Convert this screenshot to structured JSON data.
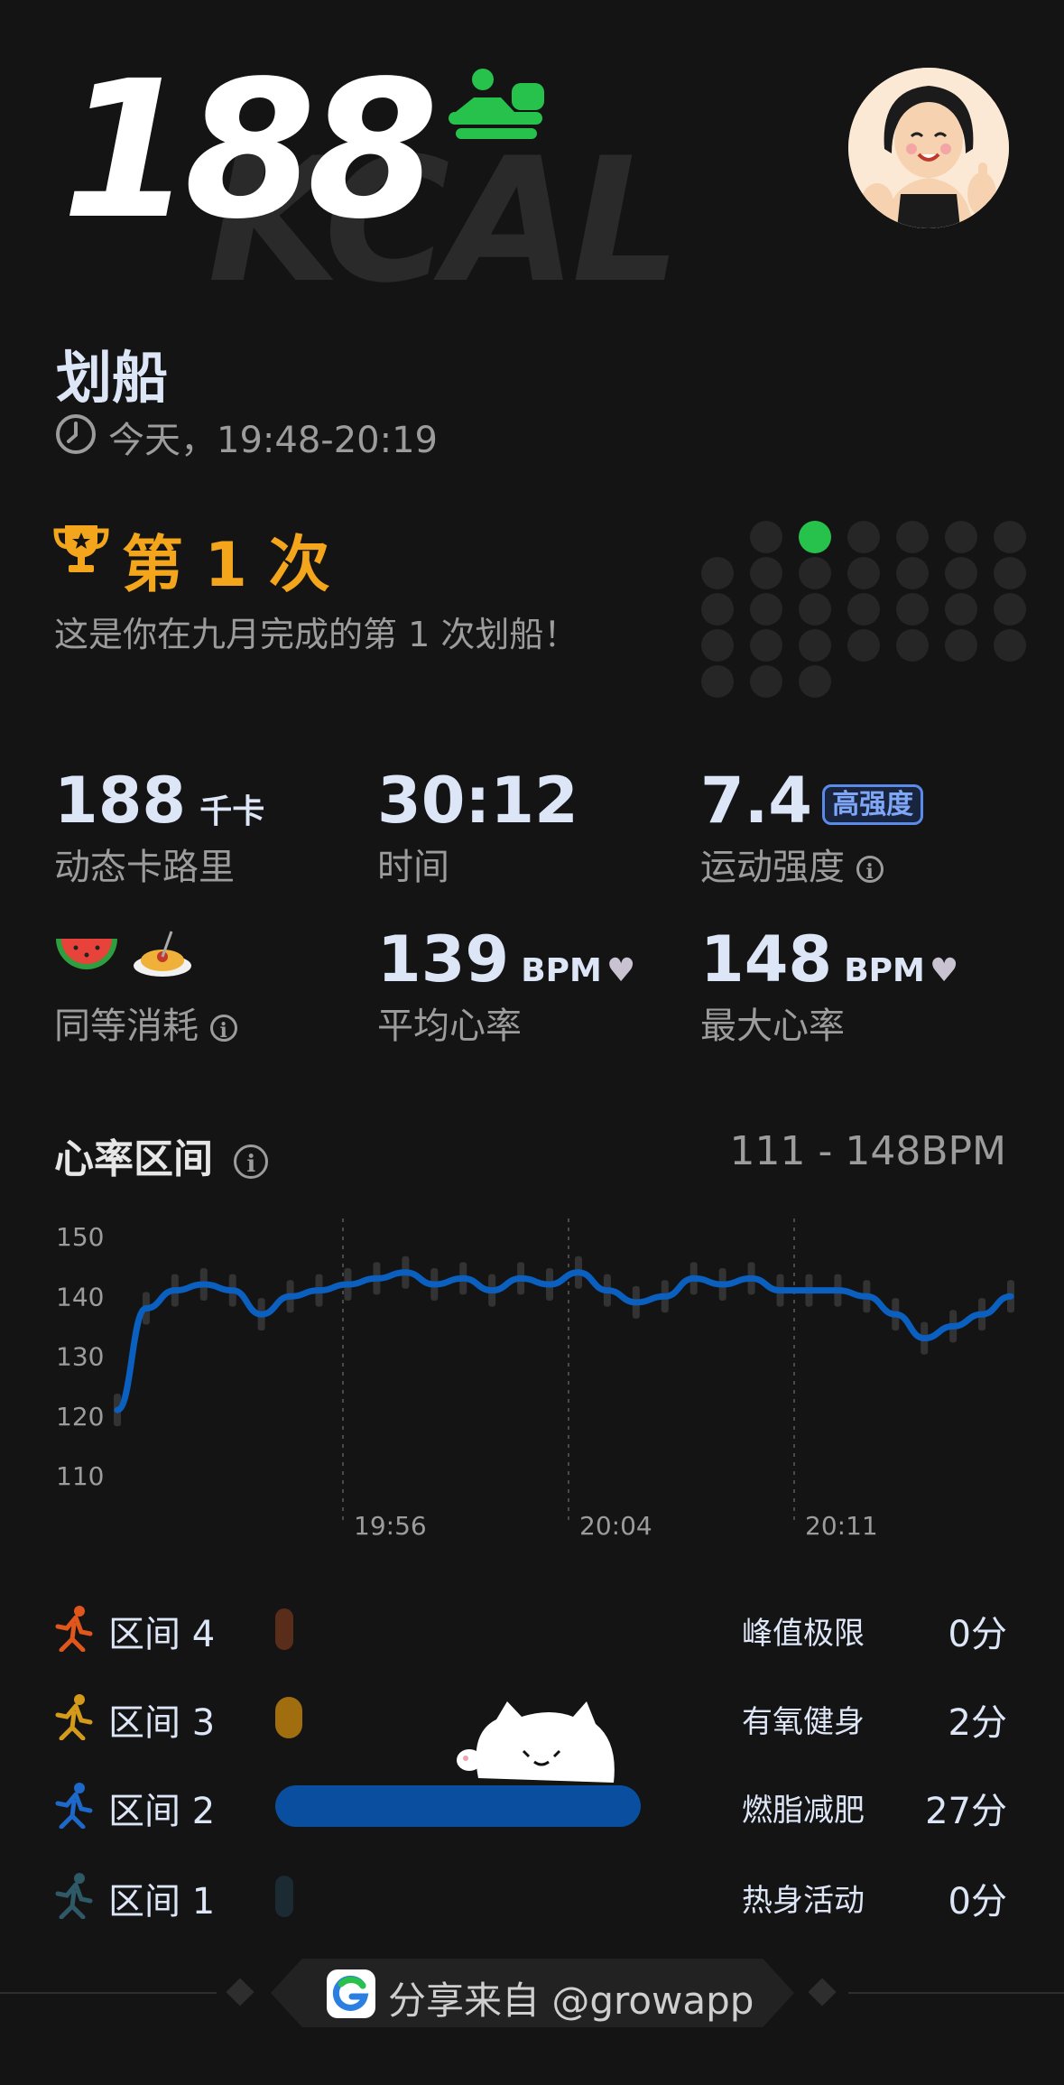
{
  "header": {
    "kcal_value": "188",
    "kcal_watermark": "KCAL",
    "activity_icon": "rowing-icon",
    "avatar": "avatar"
  },
  "activity": {
    "title": "划船",
    "time_range": "今天，19:48-20:19"
  },
  "achievement": {
    "rank": "第 1 次",
    "description": "这是你在九月完成的第 1 次划船！",
    "dots_grid_highlight_color": "#27c24c"
  },
  "stats": {
    "calories": {
      "value": "188",
      "unit": "千卡",
      "label": "动态卡路里"
    },
    "duration": {
      "value": "30:12",
      "label": "时间"
    },
    "intensity": {
      "value": "7.4",
      "badge": "高强度",
      "label": "运动强度"
    },
    "equivalent": {
      "icons": [
        "watermelon-icon",
        "spaghetti-icon"
      ],
      "label": "同等消耗"
    },
    "avg_hr": {
      "value": "139",
      "unit": "BPM",
      "label": "平均心率"
    },
    "max_hr": {
      "value": "148",
      "unit": "BPM",
      "label": "最大心率"
    }
  },
  "chart_data": {
    "type": "line",
    "title": "心率区间",
    "range_label": "111 - 148BPM",
    "ylim": [
      110,
      150
    ],
    "y_ticks": [
      "150",
      "140",
      "130",
      "120",
      "110"
    ],
    "x_ticks": [
      "19:56",
      "20:04",
      "20:11"
    ],
    "series": [
      {
        "color": "#0a5fbf",
        "x": [
          0,
          1,
          2,
          3,
          4,
          5,
          6,
          7,
          8,
          9,
          10,
          11,
          12,
          13,
          14,
          15,
          16,
          17,
          18,
          19,
          20,
          21,
          22,
          23,
          24,
          25,
          26,
          27,
          28,
          29,
          30,
          31
        ],
        "values": [
          121,
          138,
          141,
          142,
          141,
          137,
          140,
          141,
          142,
          143,
          144,
          142,
          143,
          141,
          143,
          142,
          144,
          141,
          139,
          140,
          143,
          142,
          143,
          141,
          141,
          141,
          140,
          137,
          133,
          135,
          137,
          140
        ]
      }
    ]
  },
  "zones": [
    {
      "label": "区间 4",
      "icon": "sprint-icon",
      "color": "#5a2c1a",
      "fraction": 0.0,
      "name": "峰值极限",
      "time": "0分"
    },
    {
      "label": "区间 3",
      "icon": "run-icon",
      "color": "#a06e0f",
      "fraction": 0.074,
      "name": "有氧健身",
      "time": "2分"
    },
    {
      "label": "区间 2",
      "icon": "jog-icon",
      "color": "#0a4ea0",
      "fraction": 1.0,
      "name": "燃脂减肥",
      "time": "27分"
    },
    {
      "label": "区间 1",
      "icon": "walk-icon",
      "color": "#1c2b33",
      "fraction": 0.0,
      "name": "热身活动",
      "time": "0分"
    }
  ],
  "footer": {
    "share_text": "分享来自 @growapp",
    "logo": "growapp-logo-icon"
  }
}
